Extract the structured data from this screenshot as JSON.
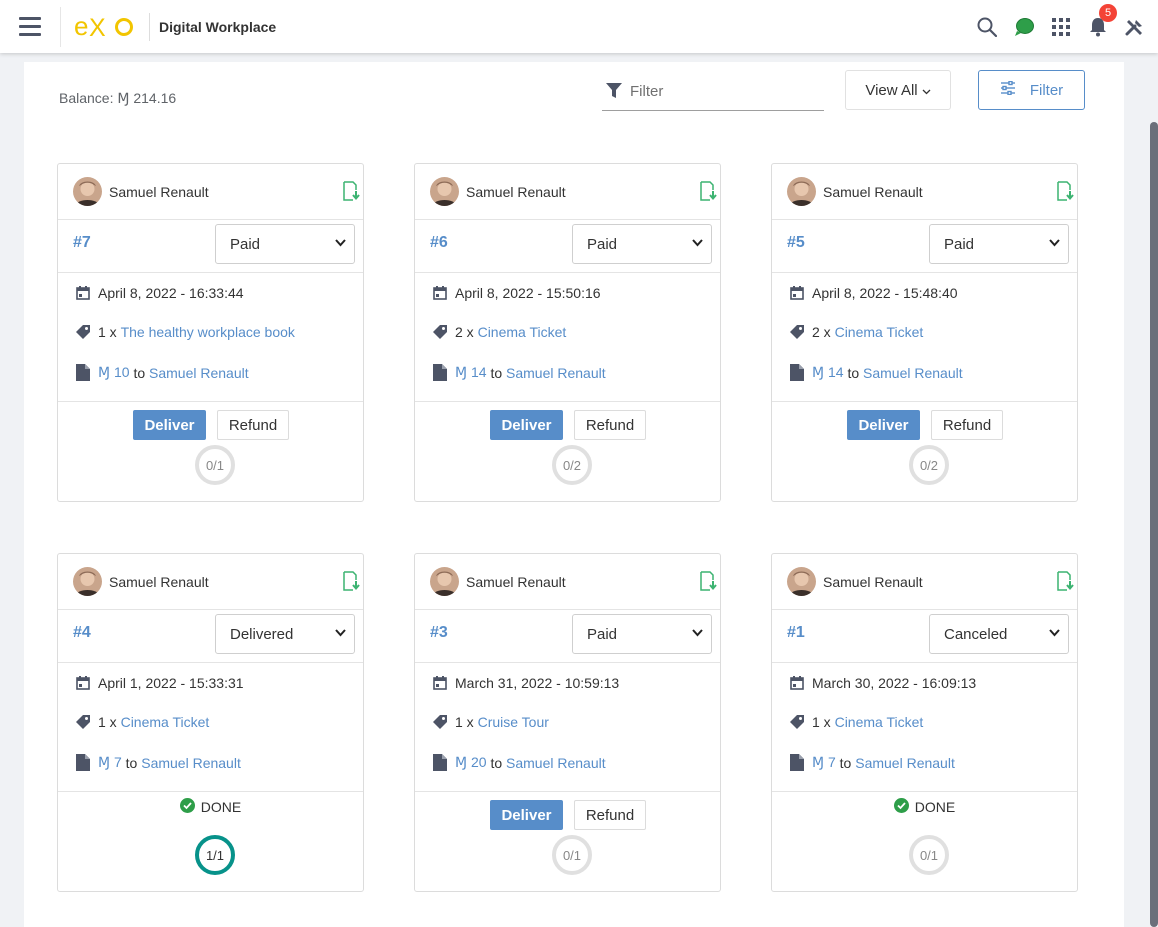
{
  "header": {
    "brand_title": "Digital Workplace",
    "notification_count": "5",
    "accent_color": "#578dc9"
  },
  "toolbar": {
    "balance": "Balance: Ɱ 214.16",
    "filter_placeholder": "Filter",
    "view_all_label": "View All",
    "filter_button_label": "Filter"
  },
  "orders": [
    {
      "user": "Samuel Renault",
      "id": "#7",
      "status": "Paid",
      "date": "April 8, 2022 - 16:33:44",
      "qty": "1 x",
      "product": "The healthy workplace book",
      "amount": "Ɱ 10",
      "to": "to",
      "recipient": "Samuel Renault",
      "deliver_label": "Deliver",
      "refund_label": "Refund",
      "progress": "0/1"
    },
    {
      "user": "Samuel Renault",
      "id": "#6",
      "status": "Paid",
      "date": "April 8, 2022 - 15:50:16",
      "qty": "2 x",
      "product": "Cinema Ticket",
      "amount": "Ɱ 14",
      "to": "to",
      "recipient": "Samuel Renault",
      "deliver_label": "Deliver",
      "refund_label": "Refund",
      "progress": "0/2"
    },
    {
      "user": "Samuel Renault",
      "id": "#5",
      "status": "Paid",
      "date": "April 8, 2022 - 15:48:40",
      "qty": "2 x",
      "product": "Cinema Ticket",
      "amount": "Ɱ 14",
      "to": "to",
      "recipient": "Samuel Renault",
      "deliver_label": "Deliver",
      "refund_label": "Refund",
      "progress": "0/2"
    },
    {
      "user": "Samuel Renault",
      "id": "#4",
      "status": "Delivered",
      "date": "April 1, 2022 - 15:33:31",
      "qty": "1 x",
      "product": "Cinema Ticket",
      "amount": "Ɱ 7",
      "to": "to",
      "recipient": "Samuel Renault",
      "done_label": "DONE",
      "progress": "1/1"
    },
    {
      "user": "Samuel Renault",
      "id": "#3",
      "status": "Paid",
      "date": "March 31, 2022 - 10:59:13",
      "qty": "1 x",
      "product": "Cruise Tour",
      "amount": "Ɱ 20",
      "to": "to",
      "recipient": "Samuel Renault",
      "deliver_label": "Deliver",
      "refund_label": "Refund",
      "progress": "0/1"
    },
    {
      "user": "Samuel Renault",
      "id": "#1",
      "status": "Canceled",
      "date": "March 30, 2022 - 16:09:13",
      "qty": "1 x",
      "product": "Cinema Ticket",
      "amount": "Ɱ 7",
      "to": "to",
      "recipient": "Samuel Renault",
      "done_label": "DONE",
      "progress": "0/1"
    }
  ]
}
